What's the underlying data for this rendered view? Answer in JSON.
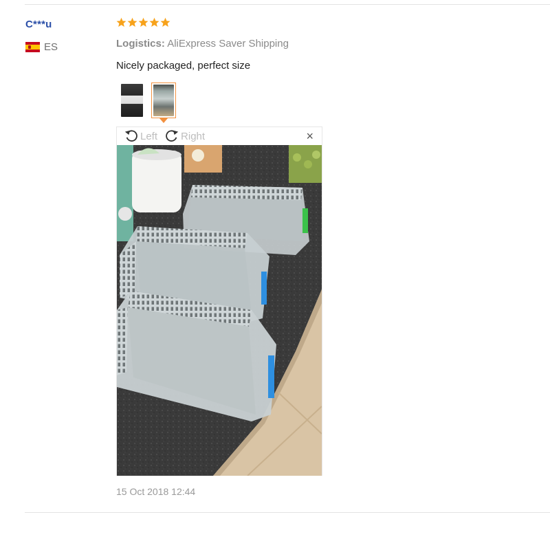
{
  "user": {
    "name": "C***u",
    "country_code": "ES",
    "flag_icon": "spain-flag-icon"
  },
  "review": {
    "rating": 5,
    "rating_max": 5,
    "star_color": "#f7a21b",
    "logistics_label": "Logistics:",
    "logistics_value": "AliExpress Saver Shipping",
    "text": "Nicely packaged, perfect size",
    "date": "15 Oct 2018 12:44"
  },
  "thumbnails": {
    "count": 2,
    "active_index": 1,
    "accent": "#f2913f"
  },
  "viewer": {
    "rotate_left_label": "Left",
    "rotate_right_label": "Right",
    "close_label": "×"
  }
}
